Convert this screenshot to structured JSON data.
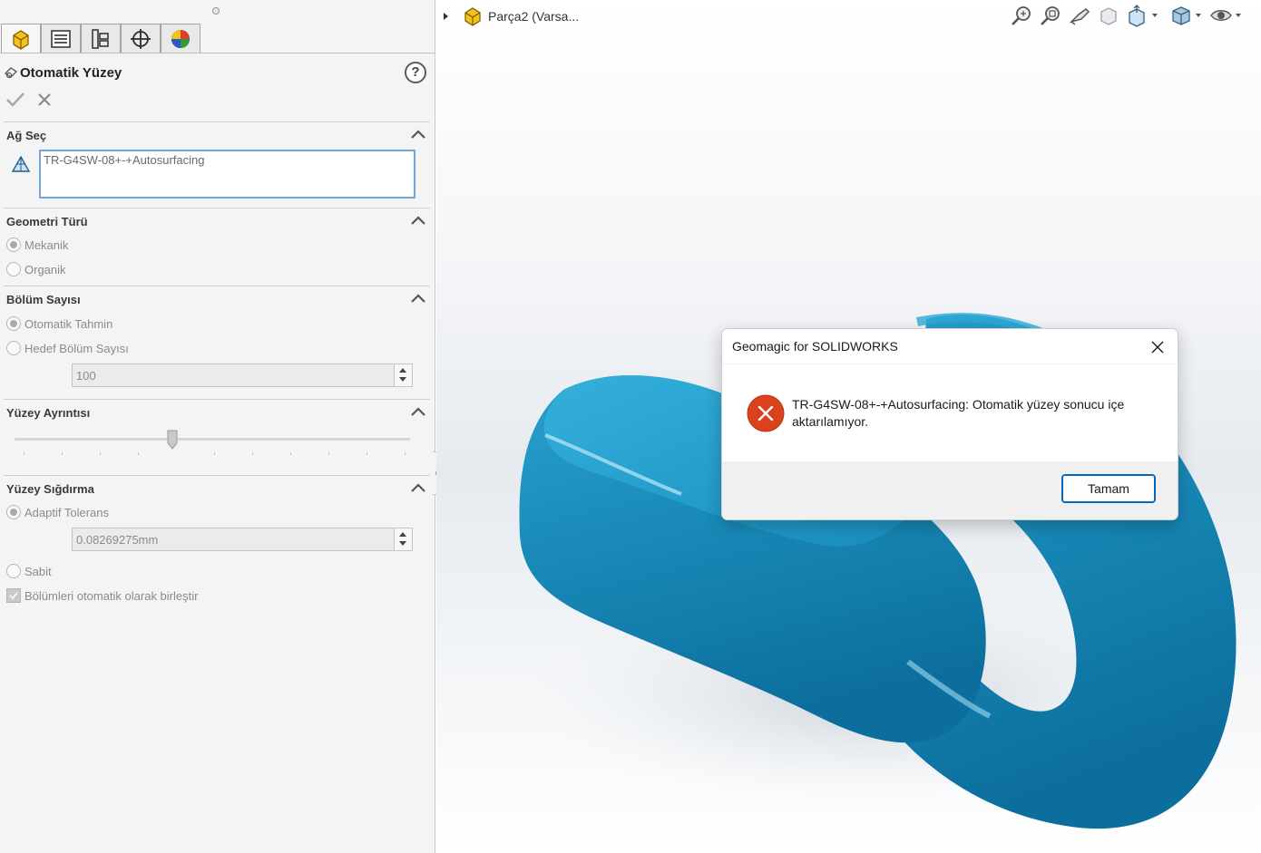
{
  "tree": {
    "part_name": "Parça2 (Varsa..."
  },
  "property_manager": {
    "tabs": [
      {
        "icon": "feature-manager-icon"
      },
      {
        "icon": "property-manager-icon"
      },
      {
        "icon": "configuration-manager-icon"
      },
      {
        "icon": "dimxpert-manager-icon"
      },
      {
        "icon": "display-manager-icon"
      }
    ],
    "title": "Otomatik Yüzey",
    "help_label": "?",
    "mesh_select": {
      "title": "Ağ Seç",
      "selected_item": "TR-G4SW-08+-+Autosurfacing"
    },
    "geometry_type": {
      "title": "Geometri Türü",
      "options": [
        "Mekanik",
        "Organik"
      ],
      "selected": "Mekanik"
    },
    "section_count": {
      "title": "Bölüm Sayısı",
      "options": [
        "Otomatik Tahmin",
        "Hedef Bölüm Sayısı"
      ],
      "selected": "Otomatik Tahmin",
      "target_value": "100"
    },
    "surface_detail": {
      "title": "Yüzey Ayrıntısı",
      "slider_level": 0.4
    },
    "surface_fitting": {
      "title": "Yüzey Sığdırma",
      "adaptive_label": "Adaptif Tolerans",
      "tolerance_value": "0.08269275mm",
      "fixed_label": "Sabit",
      "selected": "Adaptif Tolerans",
      "merge_label": "Bölümleri otomatik olarak birleştir",
      "merge_checked": true
    }
  },
  "heads_up_toolbar": [
    "zoom-to-fit-icon",
    "zoom-to-area-icon",
    "previous-view-icon",
    "section-view-icon",
    "view-orientation-icon",
    "display-style-icon",
    "hide-show-items-icon"
  ],
  "dialog": {
    "title": "Geomagic for SOLIDWORKS",
    "message": "TR-G4SW-08+-+Autosurfacing: Otomatik yüzey sonucu içe aktarılamıyor.",
    "ok_label": "Tamam",
    "icon": "error-icon"
  },
  "colors": {
    "model": "#1f93bf",
    "error": "#d9421c",
    "accent": "#0067c0"
  }
}
